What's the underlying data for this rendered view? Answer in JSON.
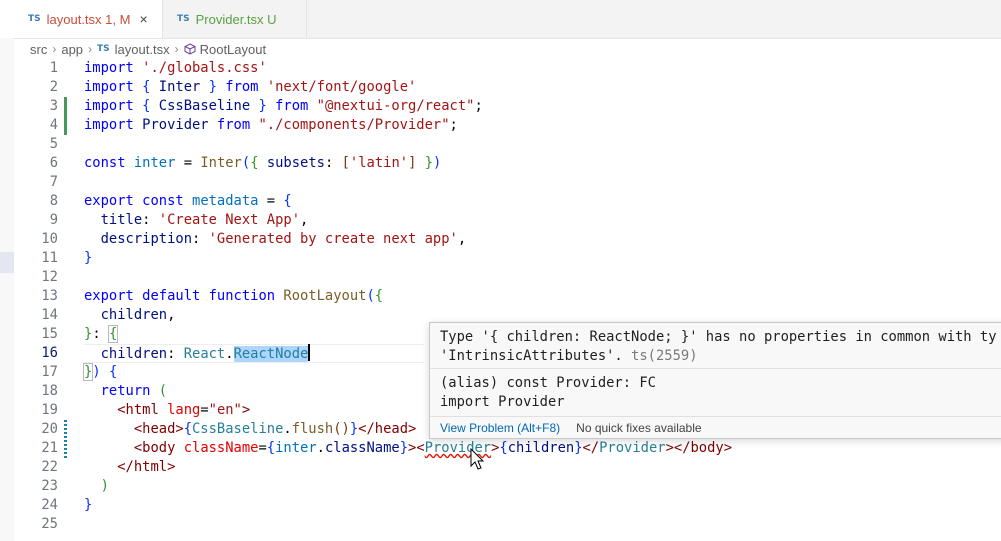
{
  "tabs": [
    {
      "badge": "TS",
      "name": "layout.tsx",
      "status": "1, M",
      "close": "×"
    },
    {
      "badge": "TS",
      "name": "Provider.tsx",
      "status": "U"
    }
  ],
  "breadcrumb": {
    "parts": [
      "src",
      "app"
    ],
    "file_badge": "TS",
    "file": "layout.tsx",
    "symbol": "RootLayout",
    "separator": "›"
  },
  "editor": {
    "line_numbers": [
      "1",
      "2",
      "3",
      "4",
      "5",
      "6",
      "7",
      "8",
      "9",
      "10",
      "11",
      "12",
      "13",
      "14",
      "15",
      "16",
      "17",
      "18",
      "19",
      "20",
      "21",
      "22",
      "23",
      "24",
      "25"
    ],
    "current_line": 16
  },
  "hover": {
    "message_line1": "Type '{ children: ReactNode; }' has no properties in common with ty",
    "message_line2": "'IntrinsicAttributes'.",
    "error_code": "ts(2559)",
    "signature_line1": "(alias) const Provider: FC",
    "signature_line2": "import Provider",
    "view_problem": "View Problem (Alt+F8)",
    "no_fixes": "No quick fixes available"
  },
  "colors": {
    "keyword": "#0000ff",
    "string": "#a31515",
    "function": "#795e26",
    "variable": "#001080",
    "type": "#267f99",
    "modified_tab": "#c74e39",
    "untracked_tab": "#5aa13f",
    "gutter_added": "#48985d",
    "gutter_modified": "#1b81a8",
    "error_squiggle": "#e51400",
    "link": "#006ab1"
  },
  "icons": {
    "tab_close": "close-icon",
    "symbol": "cube-icon",
    "mouse": "mouse-pointer-icon"
  }
}
